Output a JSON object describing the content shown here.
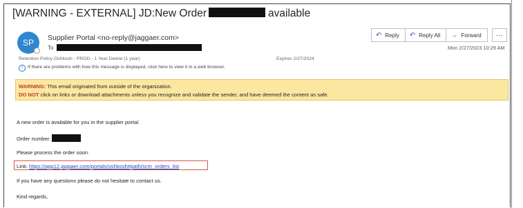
{
  "email": {
    "subject_prefix": "[WARNING - EXTERNAL] JD:New Order",
    "subject_suffix": "available",
    "avatar_initials": "SP",
    "sender": "Supplier Portal <no-reply@jaggaer.com>",
    "to_label": "To",
    "retention": "Retention Policy  Oshkosh - PROD - 1 Year Delete (1 year)",
    "expires": "Expires  2/27/2024",
    "info_notice": "If there are problems with how this message is displayed, click here to view it in a web browser.",
    "date": "Mon 2/27/2023 10:29 AM"
  },
  "actions": {
    "reply": "Reply",
    "reply_all": "Reply All",
    "forward": "Forward",
    "more": "…"
  },
  "banner": {
    "warning_label": "WARNING:",
    "warning_text": " This email originated from outside of the organization.",
    "donot_label": "DO NOT",
    "donot_text": " click on links or download attachments unless you recognize and validate the sender, and have deemed the content as safe."
  },
  "body": {
    "line1": "A new order is available for you in the supplier portal.",
    "order_label": "Order number:",
    "line3": "Please process the order soon.",
    "link_label": "Link:",
    "link_url": "https://app12.jaggaer.com/portals/oshkosh#path/scm_orders_list",
    "line5": "If you have any questions please do not hesitate to contact us.",
    "closing": "Kind regards,"
  },
  "colors": {
    "accent": "#2f87cf",
    "banner_bg": "#fce7a0",
    "warning_red": "#c0392b",
    "link_blue": "#1f4fbf",
    "highlight_box": "#d9534f"
  }
}
